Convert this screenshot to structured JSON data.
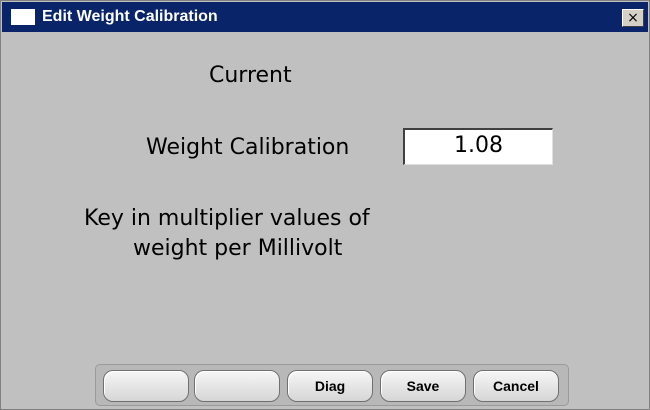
{
  "window": {
    "title": "Edit Weight Calibration",
    "close_glyph": "×"
  },
  "dialog": {
    "current_label": "Current",
    "weight_label": "Weight Calibration",
    "weight_value": "1.08",
    "hint_line_1": "Key in multiplier values of",
    "hint_line_2": "weight per Millivolt"
  },
  "buttons": [
    {
      "label": ""
    },
    {
      "label": ""
    },
    {
      "label": "Diag"
    },
    {
      "label": "Save"
    },
    {
      "label": "Cancel"
    }
  ],
  "colors": {
    "title_bar": "#0a246a",
    "window_background": "#c0c0c0",
    "input_background": "#ffffff"
  },
  "icons": {
    "app": "window-icon",
    "close": "close-icon"
  }
}
